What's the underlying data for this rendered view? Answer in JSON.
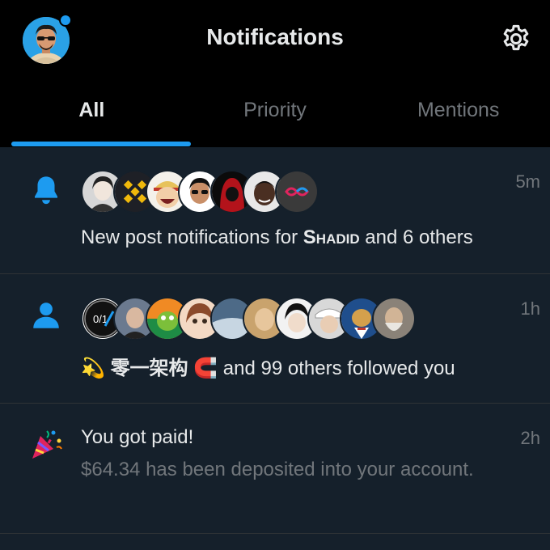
{
  "header": {
    "title": "Notifications",
    "avatar_icon": "user-avatar",
    "settings_icon": "gear-icon"
  },
  "tabs": [
    {
      "label": "All",
      "active": true
    },
    {
      "label": "Priority",
      "active": false
    },
    {
      "label": "Mentions",
      "active": false
    }
  ],
  "notifications": [
    {
      "icon": "bell-icon",
      "time": "5m",
      "avatars_count": 7,
      "text_prefix": "New post notifications for ",
      "text_name": "Shadid",
      "text_suffix": " and 6 others"
    },
    {
      "icon": "person-icon",
      "time": "1h",
      "avatars_count": 10,
      "emoji_left": "💫",
      "name": "零一架构",
      "emoji_right": "🧲",
      "text_suffix": " and 99 others followed you",
      "first_avatar_text": "0/1"
    },
    {
      "icon": "party-popper-icon",
      "time": "2h",
      "title": "You got paid!",
      "body": "$64.34 has been deposited into your account."
    }
  ],
  "colors": {
    "accent": "#1d9bf0",
    "background": "#15202b",
    "header_bg": "#000000",
    "muted": "#71767b"
  }
}
